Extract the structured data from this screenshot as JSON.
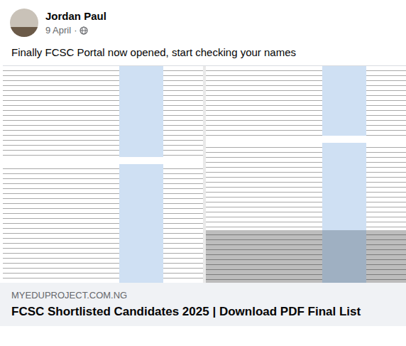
{
  "post": {
    "author": "Jordan Paul",
    "date": "9 April",
    "separator": "·",
    "text": "Finally FCSC Portal now opened, start checking your names"
  },
  "link_preview": {
    "domain": "MYEDUPROJECT.COM.NG",
    "title": "FCSC Shortlisted Candidates 2025 | Download PDF Final List"
  }
}
